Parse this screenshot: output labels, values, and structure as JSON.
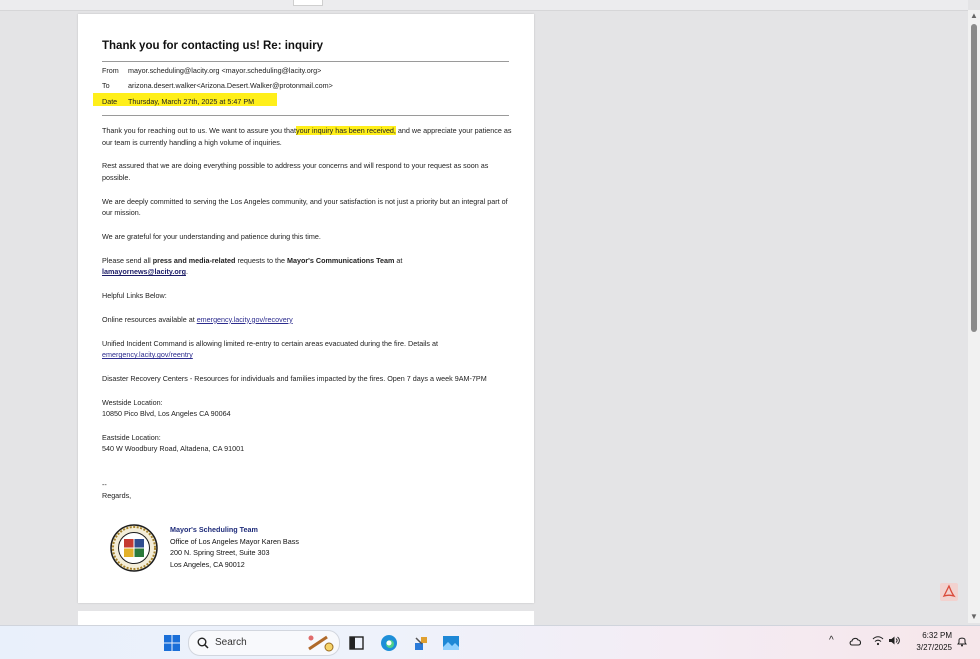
{
  "email": {
    "subject": "Thank you for contacting us! Re: inquiry",
    "from_label": "From",
    "from_value": "mayor.scheduling@lacity.org  <mayor.scheduling@lacity.org>",
    "to_label": "To",
    "to_value": "arizona.desert.walker<Arizona.Desert.Walker@protonmail.com>",
    "date_label": "Date",
    "date_value": "Thursday, March 27th, 2025 at 5:47 PM",
    "p1_a": "Thank you for reaching out to us. We want to assure you that",
    "p1_hl": "your inquiry has been received,",
    "p1_b": " and we appreciate your patience as our team is currently handling a high volume of inquiries.",
    "p2": "Rest assured that we are doing everything possible to address your concerns and will respond to your request as soon as possible.",
    "p3": "We are deeply committed to serving the Los Angeles community, and your satisfaction is not just a priority but an integral part of our mission.",
    "p4": "We are grateful for your understanding and patience during this time.",
    "p5_a": "Please send all ",
    "p5_b": "press and media-related",
    "p5_c": " requests to the ",
    "p5_d": "Mayor's Communications Team",
    "p5_e": " at",
    "p5_link": "lamayornews@lacity.org",
    "p5_end": ".",
    "p6": "Helpful Links Below:",
    "p7_a": "Online resources available at ",
    "p7_link": "emergency.lacity.gov/recovery",
    "p8_a": "Unified Incident Command is allowing limited re-entry to certain areas evacuated during the fire. Details at",
    "p8_link": "emergency.lacity.gov/reentry",
    "p9": "Disaster Recovery Centers - Resources for individuals and families impacted by the fires. Open 7 days a week 9AM-7PM",
    "west_title": "Westside Location:",
    "west_addr": "10850 Pico Blvd, Los Angeles CA 90064",
    "east_title": "Eastside Location:",
    "east_addr": "540 W Woodbury Road, Altadena, CA 91001",
    "sig_dash": "--",
    "regards": "Regards,"
  },
  "signature": {
    "name": "Mayor's Scheduling Team",
    "office": "Office of Los Angeles Mayor Karen Bass",
    "street": "200 N. Spring Street, Suite 303",
    "city": "Los Angeles, CA 90012"
  },
  "taskbar": {
    "search_placeholder": "Search",
    "time": "6:32 PM",
    "date": "3/27/2025",
    "tray_chevron": "^"
  },
  "colors": {
    "highlight": "#ffef1a",
    "link": "#2c2c8e",
    "sig_name": "#1f2c7a"
  }
}
